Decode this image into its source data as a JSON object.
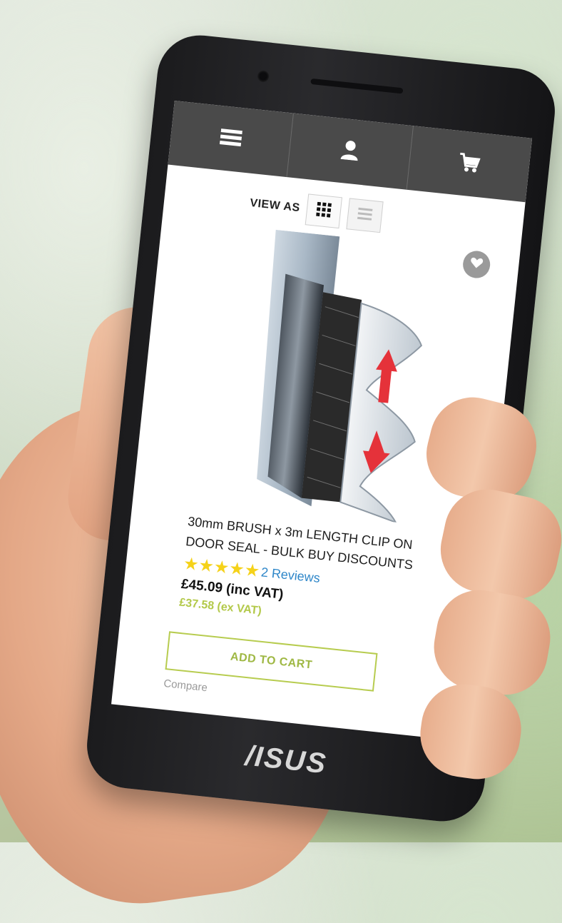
{
  "header": {
    "icons": [
      "menu-icon",
      "user-icon",
      "cart-icon"
    ],
    "bar_color": "#4a4a4a"
  },
  "view_as": {
    "label": "VIEW AS",
    "options": [
      "grid-view-icon",
      "list-view-icon"
    ],
    "selected": "grid"
  },
  "product": {
    "title_line1": "30mm BRUSH x 3m LENGTH CLIP ON",
    "title_line2": "DOOR SEAL - BULK BUY DISCOUNTS",
    "rating_stars": 5,
    "reviews_link": "2 Reviews",
    "price_inc": "£45.09 (inc VAT)",
    "price_ex": "£37.58 (ex VAT)",
    "add_to_cart": "ADD TO CART",
    "compare_label": "Compare",
    "accent_color": "#b7cc4f",
    "star_color": "#f5d21a",
    "link_color": "#2f87c9"
  },
  "device": {
    "brand": "/ISUS"
  }
}
